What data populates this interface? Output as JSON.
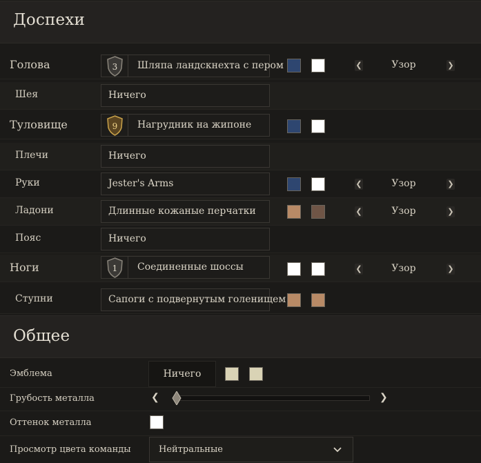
{
  "armor": {
    "title": "Доспехи",
    "pattern_label": "Узор",
    "rows": [
      {
        "label": "Голова",
        "item": "Шляпа ландскнехта с пером",
        "tier": "3",
        "colors": [
          "#2e4670",
          "#ffffff"
        ],
        "pattern": true
      },
      {
        "label": "Шея",
        "item": "Ничего"
      },
      {
        "label": "Туловище",
        "item": "Нагрудник на жипоне",
        "tier": "9",
        "colors": [
          "#2e4670",
          "#ffffff"
        ]
      },
      {
        "label": "Плечи",
        "item": "Ничего"
      },
      {
        "label": "Руки",
        "item": "Jester's Arms",
        "colors": [
          "#2e4670",
          "#ffffff"
        ],
        "pattern": true
      },
      {
        "label": "Ладони",
        "item": "Длинные кожаные перчатки",
        "colors": [
          "#b88a66",
          "#6f5546"
        ],
        "pattern": true
      },
      {
        "label": "Пояс",
        "item": "Ничего"
      },
      {
        "label": "Ноги",
        "item": "Соединенные шоссы",
        "tier": "1",
        "colors": [
          "#ffffff",
          "#ffffff"
        ],
        "pattern": true
      },
      {
        "label": "Ступни",
        "item": "Сапоги с подвернутым голенищем",
        "colors": [
          "#b88a66",
          "#b88a66"
        ]
      }
    ]
  },
  "general": {
    "title": "Общее",
    "emblem": {
      "label": "Эмблема",
      "value": "Ничего",
      "colors": [
        "#d9d3b5",
        "#d9d3b5"
      ]
    },
    "roughness": {
      "label": "Грубость металла",
      "value": 0.0
    },
    "tint": {
      "label": "Оттенок металла",
      "color": "#ffffff"
    },
    "team": {
      "label": "Просмотр цвета команды",
      "value": "Нейтральные"
    }
  }
}
